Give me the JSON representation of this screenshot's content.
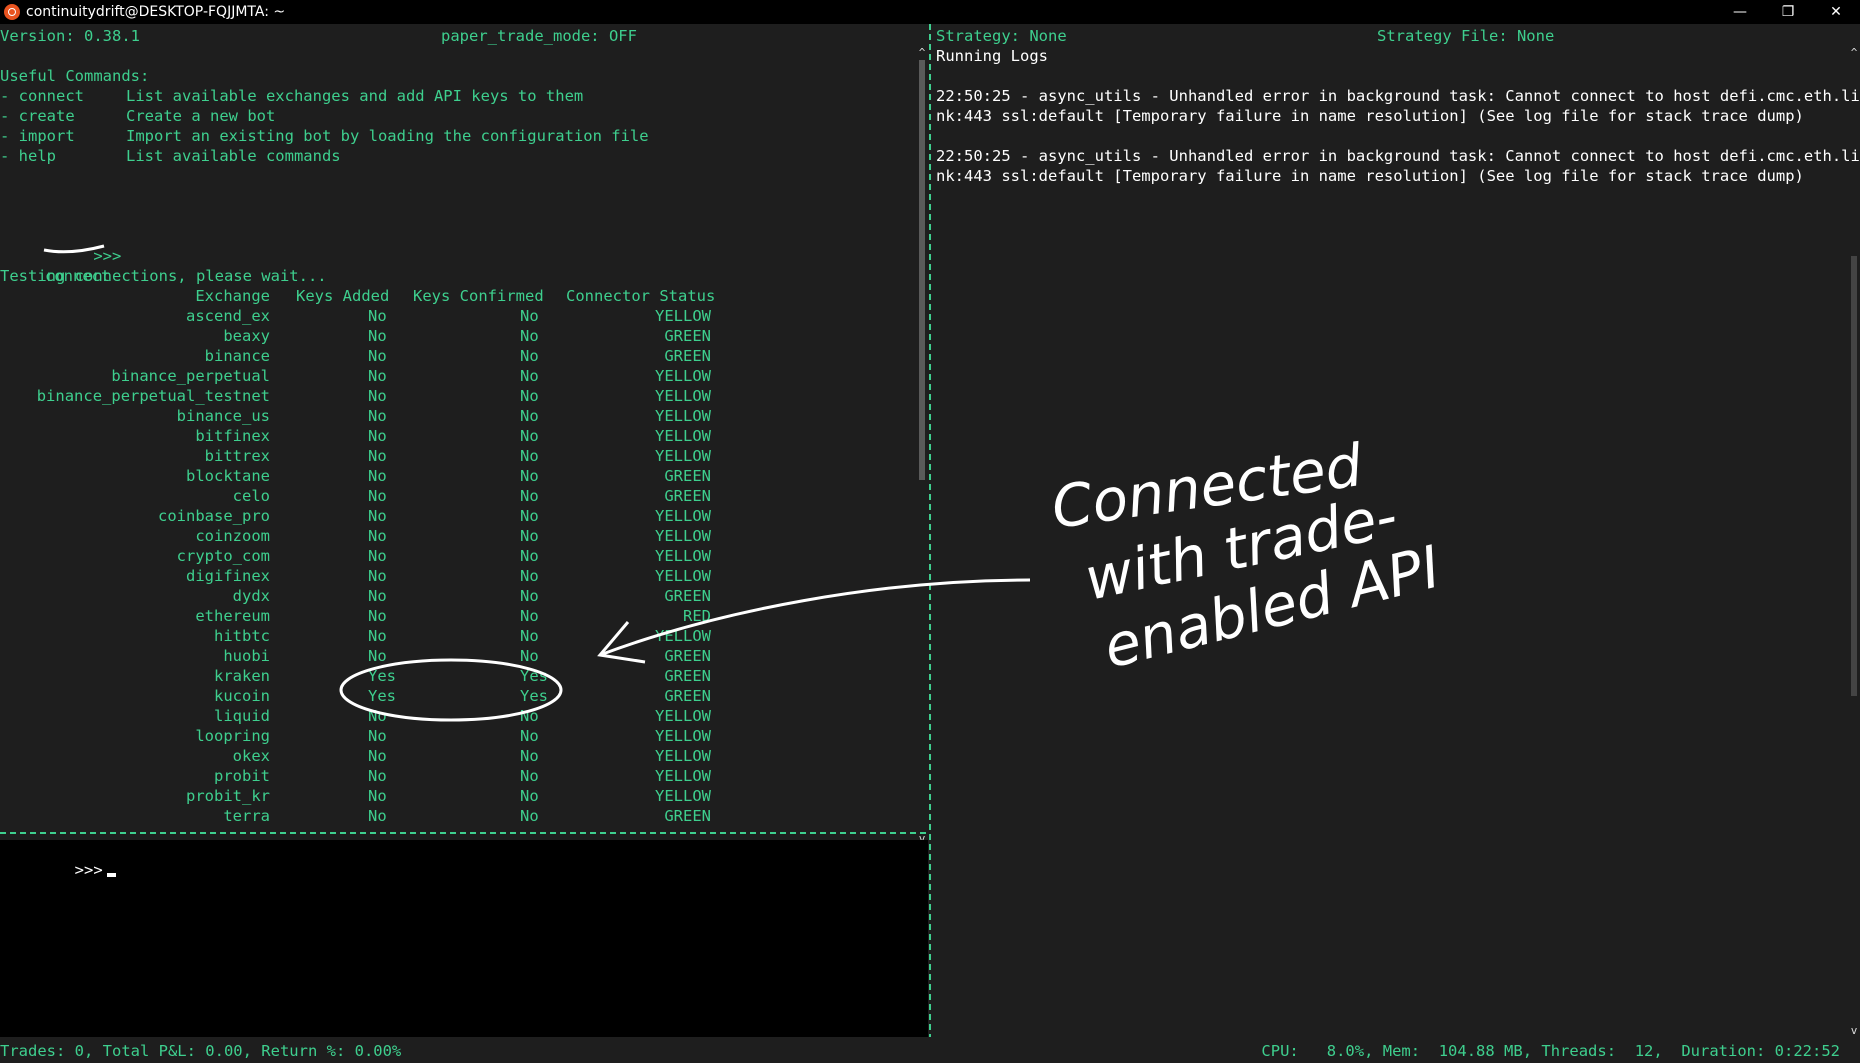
{
  "window": {
    "title": "continuitydrift@DESKTOP-FQJJMTA: ~",
    "minimize": "—",
    "restore": "❐",
    "close": "✕"
  },
  "left_header": {
    "version": "Version: 0.38.1",
    "paper_trade": "paper_trade_mode: OFF"
  },
  "right_header": {
    "strategy": "Strategy: None",
    "strategy_file": "Strategy File: None"
  },
  "useful_commands": {
    "title": "Useful Commands:",
    "items": [
      {
        "cmd": "- connect",
        "desc": "List available exchanges and add API keys to them"
      },
      {
        "cmd": "- create",
        "desc": "Create a new bot"
      },
      {
        "cmd": "- import",
        "desc": "Import an existing bot by loading the configuration file"
      },
      {
        "cmd": "- help",
        "desc": "List available commands"
      }
    ]
  },
  "prompt_echo": {
    "prompt": ">>>",
    "command": "connect"
  },
  "testing_text": "Testing connections, please wait...",
  "table": {
    "headers": {
      "exchange": "Exchange",
      "keys_added": "Keys Added",
      "keys_confirmed": "Keys Confirmed",
      "status": "Connector Status"
    },
    "rows": [
      {
        "exchange": "ascend_ex",
        "keys_added": "No",
        "keys_confirmed": "No",
        "status": "YELLOW"
      },
      {
        "exchange": "beaxy",
        "keys_added": "No",
        "keys_confirmed": "No",
        "status": "GREEN"
      },
      {
        "exchange": "binance",
        "keys_added": "No",
        "keys_confirmed": "No",
        "status": "GREEN"
      },
      {
        "exchange": "binance_perpetual",
        "keys_added": "No",
        "keys_confirmed": "No",
        "status": "YELLOW"
      },
      {
        "exchange": "binance_perpetual_testnet",
        "keys_added": "No",
        "keys_confirmed": "No",
        "status": "YELLOW"
      },
      {
        "exchange": "binance_us",
        "keys_added": "No",
        "keys_confirmed": "No",
        "status": "YELLOW"
      },
      {
        "exchange": "bitfinex",
        "keys_added": "No",
        "keys_confirmed": "No",
        "status": "YELLOW"
      },
      {
        "exchange": "bittrex",
        "keys_added": "No",
        "keys_confirmed": "No",
        "status": "YELLOW"
      },
      {
        "exchange": "blocktane",
        "keys_added": "No",
        "keys_confirmed": "No",
        "status": "GREEN"
      },
      {
        "exchange": "celo",
        "keys_added": "No",
        "keys_confirmed": "No",
        "status": "GREEN"
      },
      {
        "exchange": "coinbase_pro",
        "keys_added": "No",
        "keys_confirmed": "No",
        "status": "YELLOW"
      },
      {
        "exchange": "coinzoom",
        "keys_added": "No",
        "keys_confirmed": "No",
        "status": "YELLOW"
      },
      {
        "exchange": "crypto_com",
        "keys_added": "No",
        "keys_confirmed": "No",
        "status": "YELLOW"
      },
      {
        "exchange": "digifinex",
        "keys_added": "No",
        "keys_confirmed": "No",
        "status": "YELLOW"
      },
      {
        "exchange": "dydx",
        "keys_added": "No",
        "keys_confirmed": "No",
        "status": "GREEN"
      },
      {
        "exchange": "ethereum",
        "keys_added": "No",
        "keys_confirmed": "No",
        "status": "RED"
      },
      {
        "exchange": "hitbtc",
        "keys_added": "No",
        "keys_confirmed": "No",
        "status": "YELLOW"
      },
      {
        "exchange": "huobi",
        "keys_added": "No",
        "keys_confirmed": "No",
        "status": "GREEN"
      },
      {
        "exchange": "kraken",
        "keys_added": "Yes",
        "keys_confirmed": "Yes",
        "status": "GREEN"
      },
      {
        "exchange": "kucoin",
        "keys_added": "Yes",
        "keys_confirmed": "Yes",
        "status": "GREEN"
      },
      {
        "exchange": "liquid",
        "keys_added": "No",
        "keys_confirmed": "No",
        "status": "YELLOW"
      },
      {
        "exchange": "loopring",
        "keys_added": "No",
        "keys_confirmed": "No",
        "status": "YELLOW"
      },
      {
        "exchange": "okex",
        "keys_added": "No",
        "keys_confirmed": "No",
        "status": "YELLOW"
      },
      {
        "exchange": "probit",
        "keys_added": "No",
        "keys_confirmed": "No",
        "status": "YELLOW"
      },
      {
        "exchange": "probit_kr",
        "keys_added": "No",
        "keys_confirmed": "No",
        "status": "YELLOW"
      },
      {
        "exchange": "terra",
        "keys_added": "No",
        "keys_confirmed": "No",
        "status": "GREEN"
      }
    ]
  },
  "input": {
    "prompt": ">>>"
  },
  "logs": {
    "title": "Running Logs",
    "entries": [
      {
        "line1": "22:50:25 - async_utils - Unhandled error in background task: Cannot connect to host defi.cmc.eth.li",
        "line2": "nk:443 ssl:default [Temporary failure in name resolution] (See log file for stack trace dump)"
      },
      {
        "line1": "22:50:25 - async_utils - Unhandled error in background task: Cannot connect to host defi.cmc.eth.li",
        "line2": "nk:443 ssl:default [Temporary failure in name resolution] (See log file for stack trace dump)"
      }
    ]
  },
  "status": {
    "left": "Trades: 0, Total P&L: 0.00, Return %: 0.00%",
    "right": "CPU:   8.0%, Mem:  104.88 MB, Threads:  12,  Duration: 0:22:52"
  },
  "annotation": {
    "line1": "Connected",
    "line2": "with trade-",
    "line3": "enabled API"
  },
  "icons": {
    "scroll_up": "^",
    "scroll_down": "v"
  }
}
